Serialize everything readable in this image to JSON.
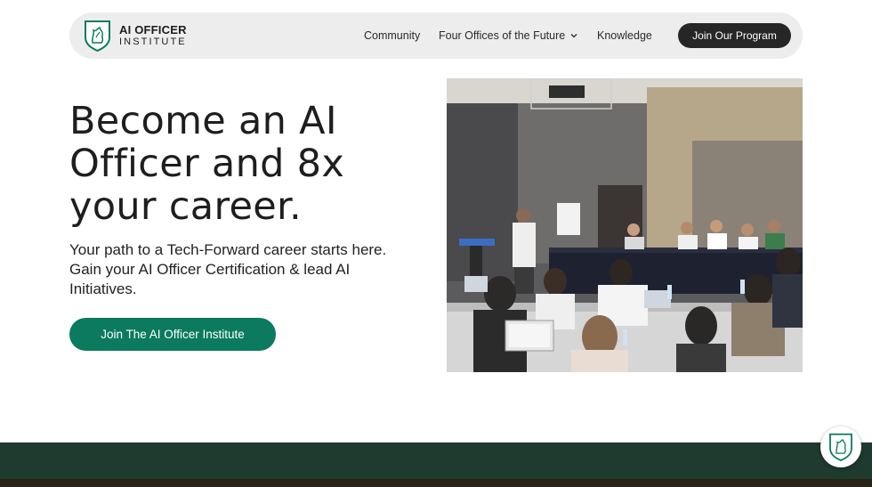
{
  "header": {
    "logo_line1": "AI OFFICER",
    "logo_line2": "INSTITUTE",
    "nav": [
      {
        "label": "Community"
      },
      {
        "label": "Four Offices of the Future",
        "icon": "chevron-down-icon"
      },
      {
        "label": "Knowledge"
      }
    ],
    "join_label": "Join Our Program"
  },
  "hero": {
    "title": "Become an AI Officer and 8x your career.",
    "subtitle": "Your path to a Tech-Forward career starts here. Gain your AI Officer Certification & lead AI Initiatives.",
    "cta_label": "Join The AI Officer Institute",
    "photo_icon": "classroom-photo"
  },
  "colors": {
    "brand_green": "#0b7a5f",
    "dark_button": "#262626",
    "nav_bg": "#ededed",
    "footer_band": "#1f3a2e"
  },
  "floating": {
    "icon": "logo-badge-icon"
  }
}
